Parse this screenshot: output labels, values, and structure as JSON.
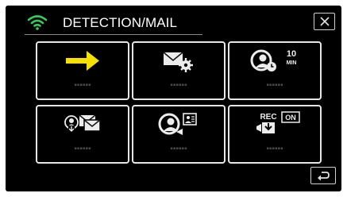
{
  "header": {
    "title": "DETECTION/MAIL",
    "wifi_icon": "wifi-icon",
    "close_icon": "close-icon"
  },
  "tiles": [
    {
      "icon": "arrow-right-icon",
      "label": "▪▪▪▪▪▪"
    },
    {
      "icon": "mail-settings-icon",
      "label": "▪▪▪▪▪▪"
    },
    {
      "icon": "face-timer-icon",
      "badge": "10 MIN",
      "badge_top": "10",
      "badge_bottom": "MIN",
      "label": "▪▪▪▪▪▪"
    },
    {
      "icon": "person-mail-icon",
      "label": "▪▪▪▪▪▪"
    },
    {
      "icon": "face-detection-icon",
      "label": "▪▪▪▪▪▪"
    },
    {
      "icon": "rec-download-icon",
      "badge_rec": "REC",
      "badge_on": "ON",
      "label": "▪▪▪▪▪▪"
    }
  ],
  "footer": {
    "return_icon": "return-icon"
  },
  "colors": {
    "background": "#000000",
    "tile_border": "#e6e6e6",
    "arrow": "#f5e000",
    "wifi": "#38c85c",
    "label": "#4a4a4a"
  }
}
